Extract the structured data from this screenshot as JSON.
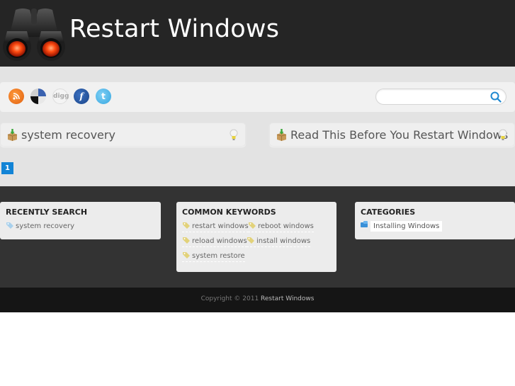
{
  "header": {
    "site_title": "Restart Windows",
    "logo_icon": "binoculars-icon"
  },
  "toolbar": {
    "social_links": [
      {
        "name": "rss",
        "icon": "rss-icon",
        "glyph": "◔",
        "color": "#f07a20"
      },
      {
        "name": "delicious",
        "icon": "delicious-icon",
        "glyph": "",
        "color": "#3a62b0"
      },
      {
        "name": "digg",
        "icon": "digg-icon",
        "glyph": "digg",
        "color": "#f4f4f4"
      },
      {
        "name": "facebook",
        "icon": "facebook-icon",
        "glyph": "f",
        "color": "#2a5aa8"
      },
      {
        "name": "twitter",
        "icon": "twitter-icon",
        "glyph": "t",
        "color": "#4ab4ea"
      }
    ],
    "search": {
      "value": "",
      "placeholder": "",
      "icon": "search-icon",
      "accent": "#1e88d0"
    }
  },
  "posts": [
    {
      "title": "system recovery"
    },
    {
      "title": "Read This Before You Restart Windows"
    }
  ],
  "pagination": {
    "current": "1",
    "accent": "#1284d6"
  },
  "widgets": {
    "recent": {
      "title": "RECENTLY SEARCH",
      "items": [
        "system recovery"
      ]
    },
    "keywords": {
      "title": "COMMON KEYWORDS",
      "items": [
        "restart windows",
        "reboot windows",
        "reload windows",
        "install windows",
        "system restore"
      ]
    },
    "categories": {
      "title": "CATEGORIES",
      "items": [
        "Installing Windows"
      ]
    }
  },
  "footer": {
    "copyright_prefix": "Copyright © 2011",
    "copyright_brand": "Restart Windows"
  }
}
